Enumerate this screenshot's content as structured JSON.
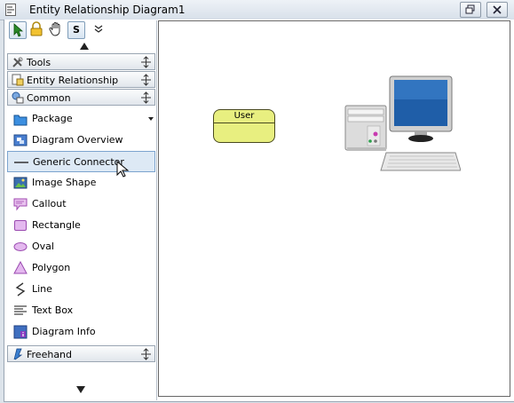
{
  "window": {
    "title": "Entity Relationship Diagram1"
  },
  "palette": {
    "categories": {
      "tools": "Tools",
      "entity_relationship": "Entity Relationship",
      "common": "Common",
      "freehand": "Freehand"
    },
    "items": [
      {
        "label": "Package",
        "icon": "package-icon"
      },
      {
        "label": "Diagram Overview",
        "icon": "diagram-overview-icon"
      },
      {
        "label": "Generic Connector",
        "icon": "connector-line-icon",
        "selected": true
      },
      {
        "label": "Image Shape",
        "icon": "image-icon"
      },
      {
        "label": "Callout",
        "icon": "callout-icon"
      },
      {
        "label": "Rectangle",
        "icon": "rectangle-icon"
      },
      {
        "label": "Oval",
        "icon": "oval-icon"
      },
      {
        "label": "Polygon",
        "icon": "polygon-icon"
      },
      {
        "label": "Line",
        "icon": "line-icon"
      },
      {
        "label": "Text Box",
        "icon": "text-box-icon"
      },
      {
        "label": "Diagram Info",
        "icon": "diagram-info-icon"
      }
    ],
    "toolbar_letter": "S"
  },
  "canvas": {
    "entity_name": "User"
  },
  "colors": {
    "entity_fill": "#e8ef80",
    "selection": "#dde9f5"
  }
}
